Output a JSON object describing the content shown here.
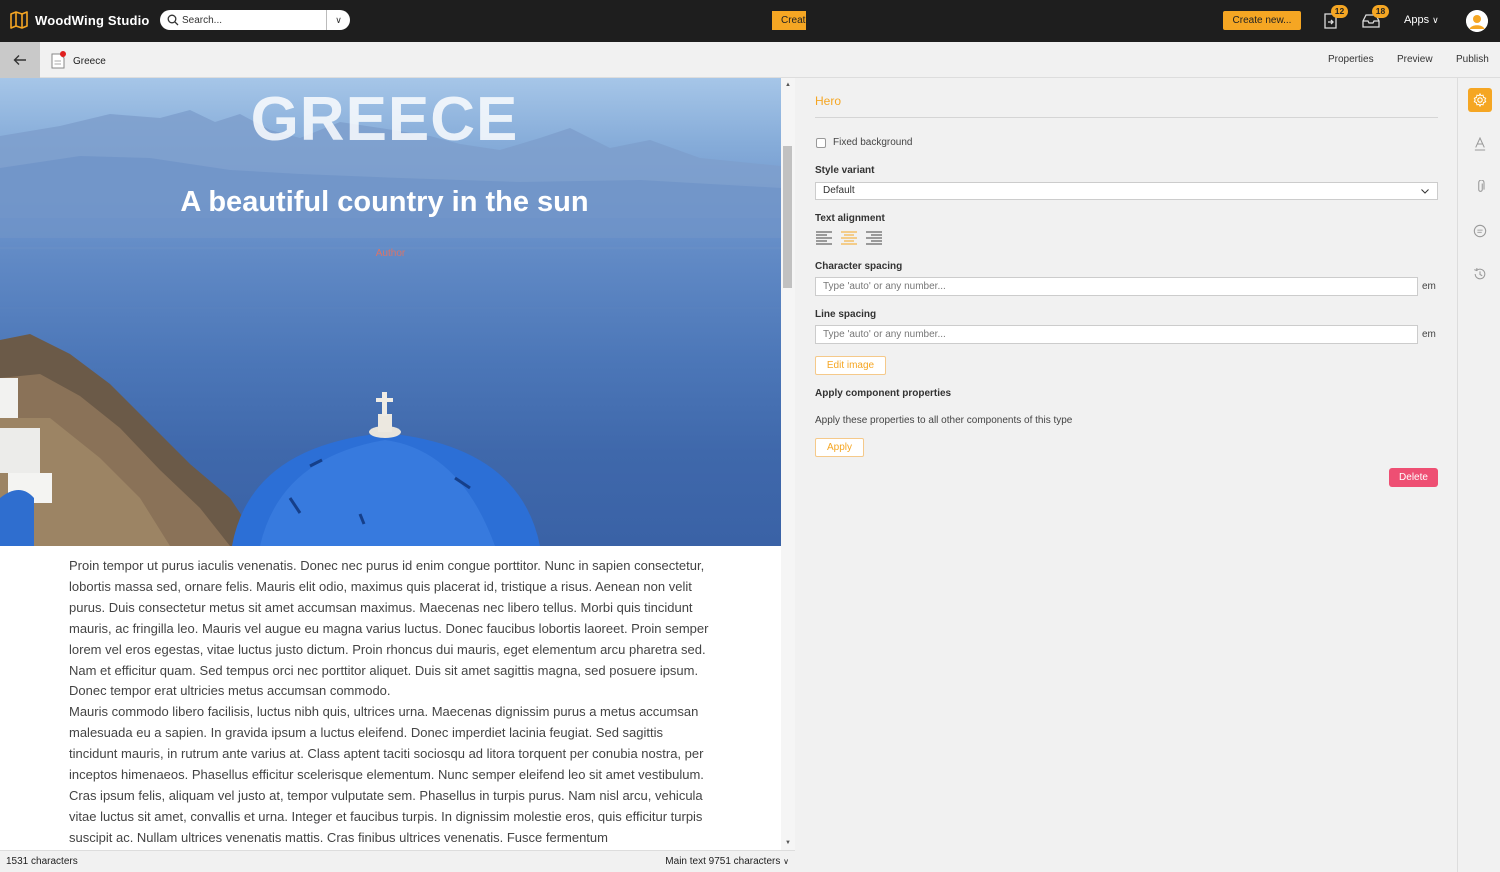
{
  "app": {
    "name": "WoodWing Studio"
  },
  "search": {
    "placeholder": "Search..."
  },
  "toolbar": {
    "create_small_label": "Create new...",
    "create_label": "Create new...",
    "tasks_count": "12",
    "inbox_count": "18",
    "apps_label": "Apps",
    "apps_chevron": "∨",
    "dropdown_chevron": "∨"
  },
  "document": {
    "title": "Greece",
    "nav": [
      "Properties",
      "Preview",
      "Publish"
    ]
  },
  "hero": {
    "title": "GREECE",
    "subtitle": "A beautiful country in the sun",
    "author": "Author"
  },
  "body": {
    "paragraphs": [
      "Proin tempor ut purus iaculis venenatis. Donec nec purus id enim congue porttitor. Nunc in sapien consectetur, lobortis massa sed, ornare felis. Mauris elit odio, maximus quis placerat id, tristique a risus. Aenean non velit purus. Duis consectetur metus sit amet accumsan maximus. Maecenas nec libero tellus. Morbi quis tincidunt mauris, ac fringilla leo. Mauris vel augue eu magna varius luctus. Donec faucibus lobortis laoreet. Proin semper lorem vel eros egestas, vitae luctus justo dictum. Proin rhoncus dui mauris, eget elementum arcu pharetra sed. Nam et efficitur quam. Sed tempus orci nec porttitor aliquet. Duis sit amet sagittis magna, sed posuere ipsum. Donec tempor erat ultricies metus accumsan commodo.",
      "Mauris commodo libero facilisis, luctus nibh quis, ultrices urna. Maecenas dignissim purus a metus accumsan malesuada eu a sapien. In gravida ipsum a luctus eleifend. Donec imperdiet lacinia feugiat. Sed sagittis tincidunt mauris, in rutrum ante varius at. Class aptent taciti sociosqu ad litora torquent per conubia nostra, per inceptos himenaeos. Phasellus efficitur scelerisque elementum. Nunc semper eleifend leo sit amet vestibulum. Cras ipsum felis, aliquam vel justo at, tempor vulputate sem. Phasellus in turpis purus. Nam nisl arcu, vehicula vitae luctus sit amet, convallis et urna. Integer et faucibus turpis. In dignissim molestie eros, quis efficitur turpis suscipit ac. Nullam ultrices venenatis mattis. Cras finibus ultrices venenatis. Fusce fermentum"
    ]
  },
  "status": {
    "char_count": "1531 characters",
    "main_text": "Main text 9751 characters",
    "chevron": "∨"
  },
  "panel": {
    "title": "Hero",
    "fixed_background_label": "Fixed background",
    "style_variant_label": "Style variant",
    "style_variant_value": "Default",
    "text_alignment_label": "Text alignment",
    "character_spacing_label": "Character spacing",
    "character_spacing_placeholder": "Type 'auto' or any number...",
    "line_spacing_label": "Line spacing",
    "line_spacing_placeholder": "Type 'auto' or any number...",
    "unit": "em",
    "edit_image_label": "Edit image",
    "apply_component_label": "Apply component properties",
    "apply_description": "Apply these properties to all other components of this type",
    "apply_label": "Apply",
    "delete_label": "Delete"
  },
  "colors": {
    "accent": "#f5a623",
    "delete": "#ee4f73",
    "topbar": "#1e1e1e"
  }
}
